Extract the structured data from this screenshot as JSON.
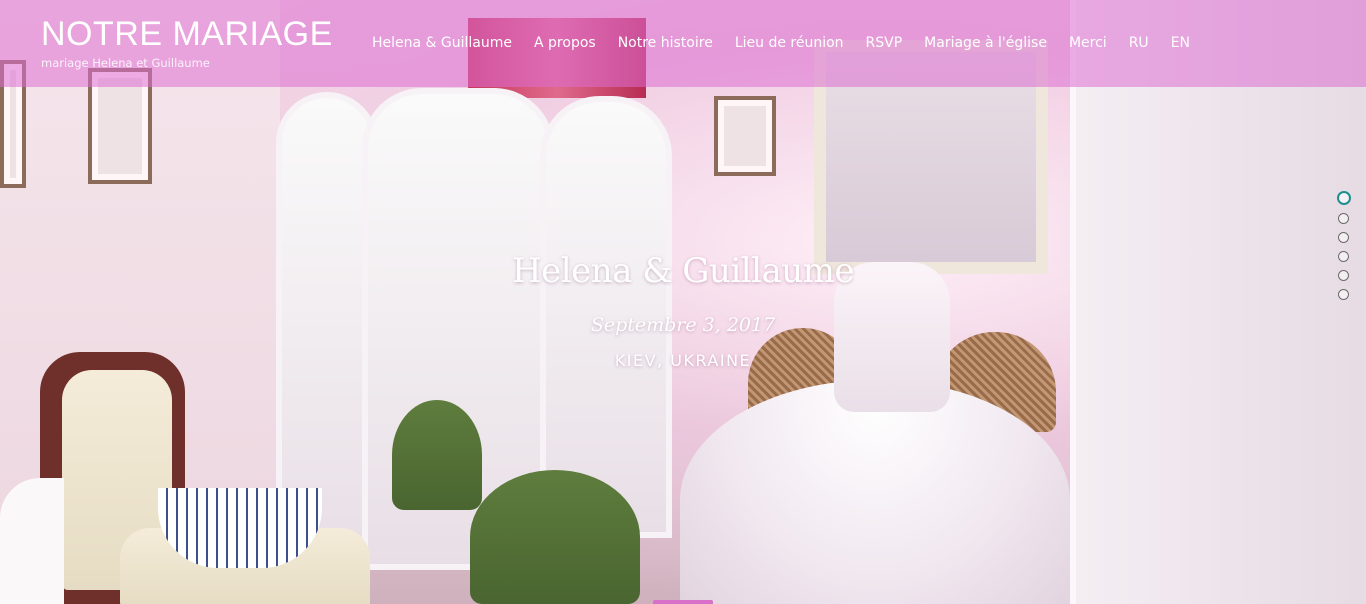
{
  "brand": {
    "title": "NOTRE MARIAGE",
    "subtitle": "mariage Helena et Guillaume"
  },
  "nav": {
    "items": [
      {
        "label": "Helena & Guillaume"
      },
      {
        "label": "A propos"
      },
      {
        "label": "Notre histoire"
      },
      {
        "label": "Lieu de réunion"
      },
      {
        "label": "RSVP"
      },
      {
        "label": "Mariage à l'église"
      },
      {
        "label": "Merci"
      },
      {
        "label": "RU"
      },
      {
        "label": "EN"
      }
    ]
  },
  "hero": {
    "names": "Helena & Guillaume",
    "date": "Septembre 3, 2017",
    "place": "KIEV, UKRAINE"
  },
  "section_dots": {
    "count": 6,
    "active_index": 0
  },
  "colors": {
    "navbar": "#dc6ed2",
    "active_dot": "#1e8f8f"
  }
}
